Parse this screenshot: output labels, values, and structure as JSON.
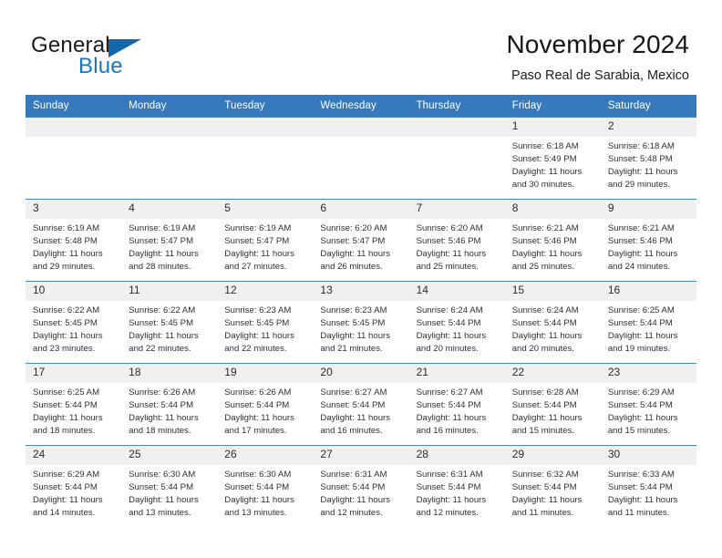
{
  "logo": {
    "word_one": "General",
    "word_two": "Blue",
    "triangle": "triangle-icon"
  },
  "header": {
    "title": "November 2024",
    "subtitle": "Paso Real de Sarabia, Mexico"
  },
  "calendar": {
    "weekday_headers": [
      "Sunday",
      "Monday",
      "Tuesday",
      "Wednesday",
      "Thursday",
      "Friday",
      "Saturday"
    ],
    "accent_color": "#3679bc",
    "row_border_color": "#4a86c5",
    "daynum_background": "#f0f0f0",
    "weeks": [
      [
        {
          "day": "",
          "blank": true
        },
        {
          "day": "",
          "blank": true
        },
        {
          "day": "",
          "blank": true
        },
        {
          "day": "",
          "blank": true
        },
        {
          "day": "",
          "blank": true
        },
        {
          "day": "1",
          "sunrise": "Sunrise: 6:18 AM",
          "sunset": "Sunset: 5:49 PM",
          "daylight": "Daylight: 11 hours and 30 minutes."
        },
        {
          "day": "2",
          "sunrise": "Sunrise: 6:18 AM",
          "sunset": "Sunset: 5:48 PM",
          "daylight": "Daylight: 11 hours and 29 minutes."
        }
      ],
      [
        {
          "day": "3",
          "sunrise": "Sunrise: 6:19 AM",
          "sunset": "Sunset: 5:48 PM",
          "daylight": "Daylight: 11 hours and 29 minutes."
        },
        {
          "day": "4",
          "sunrise": "Sunrise: 6:19 AM",
          "sunset": "Sunset: 5:47 PM",
          "daylight": "Daylight: 11 hours and 28 minutes."
        },
        {
          "day": "5",
          "sunrise": "Sunrise: 6:19 AM",
          "sunset": "Sunset: 5:47 PM",
          "daylight": "Daylight: 11 hours and 27 minutes."
        },
        {
          "day": "6",
          "sunrise": "Sunrise: 6:20 AM",
          "sunset": "Sunset: 5:47 PM",
          "daylight": "Daylight: 11 hours and 26 minutes."
        },
        {
          "day": "7",
          "sunrise": "Sunrise: 6:20 AM",
          "sunset": "Sunset: 5:46 PM",
          "daylight": "Daylight: 11 hours and 25 minutes."
        },
        {
          "day": "8",
          "sunrise": "Sunrise: 6:21 AM",
          "sunset": "Sunset: 5:46 PM",
          "daylight": "Daylight: 11 hours and 25 minutes."
        },
        {
          "day": "9",
          "sunrise": "Sunrise: 6:21 AM",
          "sunset": "Sunset: 5:46 PM",
          "daylight": "Daylight: 11 hours and 24 minutes."
        }
      ],
      [
        {
          "day": "10",
          "sunrise": "Sunrise: 6:22 AM",
          "sunset": "Sunset: 5:45 PM",
          "daylight": "Daylight: 11 hours and 23 minutes."
        },
        {
          "day": "11",
          "sunrise": "Sunrise: 6:22 AM",
          "sunset": "Sunset: 5:45 PM",
          "daylight": "Daylight: 11 hours and 22 minutes."
        },
        {
          "day": "12",
          "sunrise": "Sunrise: 6:23 AM",
          "sunset": "Sunset: 5:45 PM",
          "daylight": "Daylight: 11 hours and 22 minutes."
        },
        {
          "day": "13",
          "sunrise": "Sunrise: 6:23 AM",
          "sunset": "Sunset: 5:45 PM",
          "daylight": "Daylight: 11 hours and 21 minutes."
        },
        {
          "day": "14",
          "sunrise": "Sunrise: 6:24 AM",
          "sunset": "Sunset: 5:44 PM",
          "daylight": "Daylight: 11 hours and 20 minutes."
        },
        {
          "day": "15",
          "sunrise": "Sunrise: 6:24 AM",
          "sunset": "Sunset: 5:44 PM",
          "daylight": "Daylight: 11 hours and 20 minutes."
        },
        {
          "day": "16",
          "sunrise": "Sunrise: 6:25 AM",
          "sunset": "Sunset: 5:44 PM",
          "daylight": "Daylight: 11 hours and 19 minutes."
        }
      ],
      [
        {
          "day": "17",
          "sunrise": "Sunrise: 6:25 AM",
          "sunset": "Sunset: 5:44 PM",
          "daylight": "Daylight: 11 hours and 18 minutes."
        },
        {
          "day": "18",
          "sunrise": "Sunrise: 6:26 AM",
          "sunset": "Sunset: 5:44 PM",
          "daylight": "Daylight: 11 hours and 18 minutes."
        },
        {
          "day": "19",
          "sunrise": "Sunrise: 6:26 AM",
          "sunset": "Sunset: 5:44 PM",
          "daylight": "Daylight: 11 hours and 17 minutes."
        },
        {
          "day": "20",
          "sunrise": "Sunrise: 6:27 AM",
          "sunset": "Sunset: 5:44 PM",
          "daylight": "Daylight: 11 hours and 16 minutes."
        },
        {
          "day": "21",
          "sunrise": "Sunrise: 6:27 AM",
          "sunset": "Sunset: 5:44 PM",
          "daylight": "Daylight: 11 hours and 16 minutes."
        },
        {
          "day": "22",
          "sunrise": "Sunrise: 6:28 AM",
          "sunset": "Sunset: 5:44 PM",
          "daylight": "Daylight: 11 hours and 15 minutes."
        },
        {
          "day": "23",
          "sunrise": "Sunrise: 6:29 AM",
          "sunset": "Sunset: 5:44 PM",
          "daylight": "Daylight: 11 hours and 15 minutes."
        }
      ],
      [
        {
          "day": "24",
          "sunrise": "Sunrise: 6:29 AM",
          "sunset": "Sunset: 5:44 PM",
          "daylight": "Daylight: 11 hours and 14 minutes."
        },
        {
          "day": "25",
          "sunrise": "Sunrise: 6:30 AM",
          "sunset": "Sunset: 5:44 PM",
          "daylight": "Daylight: 11 hours and 13 minutes."
        },
        {
          "day": "26",
          "sunrise": "Sunrise: 6:30 AM",
          "sunset": "Sunset: 5:44 PM",
          "daylight": "Daylight: 11 hours and 13 minutes."
        },
        {
          "day": "27",
          "sunrise": "Sunrise: 6:31 AM",
          "sunset": "Sunset: 5:44 PM",
          "daylight": "Daylight: 11 hours and 12 minutes."
        },
        {
          "day": "28",
          "sunrise": "Sunrise: 6:31 AM",
          "sunset": "Sunset: 5:44 PM",
          "daylight": "Daylight: 11 hours and 12 minutes."
        },
        {
          "day": "29",
          "sunrise": "Sunrise: 6:32 AM",
          "sunset": "Sunset: 5:44 PM",
          "daylight": "Daylight: 11 hours and 11 minutes."
        },
        {
          "day": "30",
          "sunrise": "Sunrise: 6:33 AM",
          "sunset": "Sunset: 5:44 PM",
          "daylight": "Daylight: 11 hours and 11 minutes."
        }
      ]
    ]
  }
}
